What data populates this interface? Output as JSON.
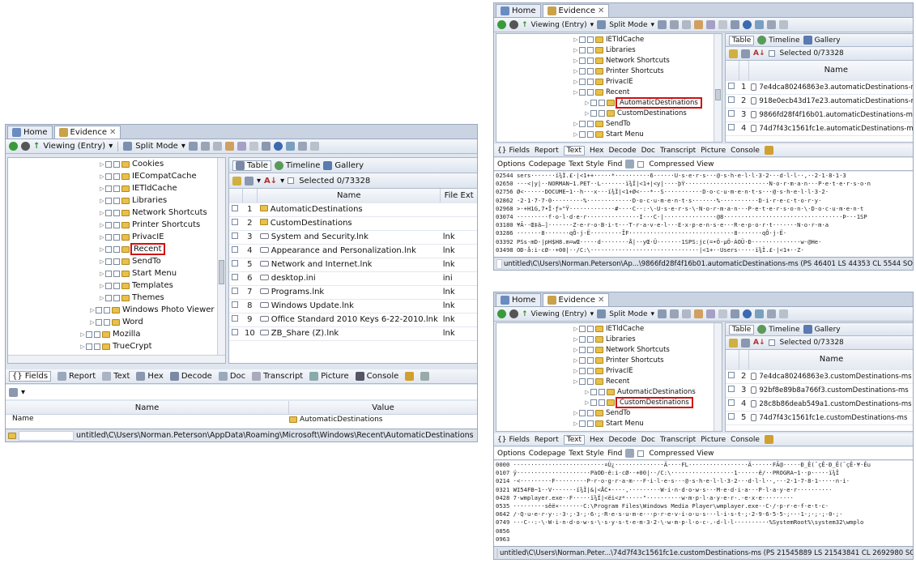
{
  "common": {
    "tab_home": "Home",
    "tab_evidence": "Evidence",
    "viewing": "Viewing (Entry)",
    "split_mode": "Split Mode",
    "table": "Table",
    "timeline": "Timeline",
    "gallery": "Gallery",
    "selected": "Selected 0/73328",
    "col_name": "Name",
    "col_file_ext": "File Ext",
    "fields": "Fields",
    "report": "Report",
    "text": "Text",
    "hex": "Hex",
    "decode": "Decode",
    "doc": "Doc",
    "transcript": "Transcript",
    "picture": "Picture",
    "console": "Console",
    "options": "Options",
    "codepage": "Codepage",
    "text_style": "Text Style",
    "find": "Find",
    "compressed_view": "Compressed View",
    "col_value": "Value"
  },
  "left": {
    "tree": [
      {
        "label": "Cookies",
        "indent": 0
      },
      {
        "label": "IECompatCache",
        "indent": 0
      },
      {
        "label": "IETldCache",
        "indent": 0
      },
      {
        "label": "Libraries",
        "indent": 0
      },
      {
        "label": "Network Shortcuts",
        "indent": 0
      },
      {
        "label": "Printer Shortcuts",
        "indent": 0
      },
      {
        "label": "PrivacIE",
        "indent": 0
      },
      {
        "label": "Recent",
        "indent": 0,
        "hl": true
      },
      {
        "label": "SendTo",
        "indent": 0
      },
      {
        "label": "Start Menu",
        "indent": 0
      },
      {
        "label": "Templates",
        "indent": 0
      },
      {
        "label": "Themes",
        "indent": 0
      },
      {
        "label": "Windows Photo Viewer",
        "indent": -1
      },
      {
        "label": "Word",
        "indent": -1
      },
      {
        "label": "Mozilla",
        "indent": -2
      },
      {
        "label": "TrueCrypt",
        "indent": -2
      }
    ],
    "rows": [
      {
        "n": "1",
        "name": "AutomaticDestinations",
        "ext": "",
        "folder": true
      },
      {
        "n": "2",
        "name": "CustomDestinations",
        "ext": "",
        "folder": true
      },
      {
        "n": "3",
        "name": "System and Security.lnk",
        "ext": "lnk"
      },
      {
        "n": "4",
        "name": "Appearance and Personalization.lnk",
        "ext": "lnk"
      },
      {
        "n": "5",
        "name": "Network and Internet.lnk",
        "ext": "lnk"
      },
      {
        "n": "6",
        "name": "desktop.ini",
        "ext": "ini"
      },
      {
        "n": "7",
        "name": "Programs.lnk",
        "ext": "lnk"
      },
      {
        "n": "8",
        "name": "Windows Update.lnk",
        "ext": "lnk"
      },
      {
        "n": "9",
        "name": "Office Standard 2010 Keys 6-22-2010.lnk",
        "ext": "lnk"
      },
      {
        "n": "10",
        "name": "ZB_Share (Z).lnk",
        "ext": "lnk"
      }
    ],
    "fields_row_name": "Name",
    "fields_row_value": "AutomaticDestinations",
    "status_path": "untitled\\C\\Users\\Norman.Peterson\\AppData\\Roaming\\Microsoft\\Windows\\Recent\\AutomaticDestinations"
  },
  "topright": {
    "tree": [
      {
        "label": "IETldCache"
      },
      {
        "label": "Libraries"
      },
      {
        "label": "Network Shortcuts"
      },
      {
        "label": "Printer Shortcuts"
      },
      {
        "label": "PrivacIE"
      },
      {
        "label": "Recent"
      },
      {
        "label": "AutomaticDestinations",
        "sub": true,
        "hl": true
      },
      {
        "label": "CustomDestinations",
        "sub": true
      },
      {
        "label": "SendTo"
      },
      {
        "label": "Start Menu"
      }
    ],
    "rows": [
      {
        "n": "1",
        "name": "7e4dca80246863e3.automaticDestinations-ms"
      },
      {
        "n": "2",
        "name": "918e0ecb43d17e23.automaticDestinations-ms"
      },
      {
        "n": "3",
        "name": "9866fd28f4f16b01.automaticDestinations-ms"
      },
      {
        "n": "4",
        "name": "74d7f43c1561fc1e.automaticDestinations-ms"
      }
    ],
    "hex": [
      "02544 sers·······ï¾Ï.£·|<1++·····*··········6······U·s·e·r·s···@·s·h·e·l·l·3·2···d·l·l··,··2·1·8·1·3",
      "02650 ···<|y|··NORMAN~1.PET··L·······ï¾Ï|<1+|<y|····þÝ························N·o·r·m·a·n···P·e·t·e·r·s·o·n",
      "02756 Ø<······DOCUME~1··h···x···ï¾Ï|<1+Ø<···*··S···········D·o·c·u·m·e·n·t·s···@·s·h·e·l·l·3·2·",
      "02862 ·2·1·7·7·0·········%·············D·o·c·u·m·e·n·t·s·······%···········D·i·r·e·c·t·o·r·y·",
      "02968 >·+H1G,7•Î·ƒ»\"Ÿ·············#····C··:·\\·U·s·e·r·s·\\·N·o·r·m·a·n···P·e·t·e·r·s·o·n·\\·D·o·c·u·m·e·n·t",
      "03074 ·········f·o·l·d·e·r···············I···C·|···············@8··································Þ···1SP",
      "03180 ¥Ã··Œ‡ä—]·······Z·e·r·o·B·i·t···T·r·a·v·e·l···E·x·p·e·n·s·e···R·e·p·o·r·t···-···N·o·r·m·a",
      "03286 ·······8·······qÔ·j·Ë·········ÎF······························8·······qÔ·j·Ë·",
      "03392 PSs·mD-|pH$H8.m=wŒ·····d········Å|··yŒ·Ü·······1SPS:jc(=•Ö·µÖ·ÀOÜ·Ð··············w·@He·",
      "03498 OÐ·å:i·cØ··+00|··/C:\\·······························|<1+··Users·····ï¾Ï.£·|<1+··Z·"
    ],
    "status_path": "untitled\\C\\Users\\Norman.Peterson\\Ap...\\9866fd28f4f16b01.automaticDestinations-ms (PS 46401 LS 44353 CL 5544 SO"
  },
  "bottomright": {
    "tree": [
      {
        "label": "IETldCache"
      },
      {
        "label": "Libraries"
      },
      {
        "label": "Network Shortcuts"
      },
      {
        "label": "Printer Shortcuts"
      },
      {
        "label": "PrivacIE"
      },
      {
        "label": "Recent"
      },
      {
        "label": "AutomaticDestinations",
        "sub": true
      },
      {
        "label": "CustomDestinations",
        "sub": true,
        "hl": true
      },
      {
        "label": "SendTo"
      },
      {
        "label": "Start Menu"
      }
    ],
    "rows": [
      {
        "n": "2",
        "name": "7e4dca80246863e3.customDestinations-ms"
      },
      {
        "n": "3",
        "name": "92bf8e89b8a766f3.customDestinations-ms"
      },
      {
        "n": "4",
        "name": "28c8b86deab549a1.customDestinations-ms"
      },
      {
        "n": "5",
        "name": "74d7f43c1561fc1e.customDestinations-ms"
      }
    ],
    "hex": [
      "0000 ··························¤Ù¿··············Ä····FL·················Ä······FÃ@·····Ð_Ê(¯çÊ·Ð_Ê(¯çÊ·¥·Êu",
      "0107 ÿ·····················PàOÐ·ê:i·cØ··+00|··/C:\\··················1······ê/··PROGRA~1··p·····ï¾Ï",
      "0214 ·<·········F·········P·r·o·g·r·a·m···F·i·l·e·s···@·s·h·e·l·l·3·2···d·l·l··,···2·1·7·8·1·····n·i·",
      "0321 WI54FB~1··V·······ï¾Ï|&|<ÅC•····,·········W·i·n·d·o·w·s···M·e·d·i·a···P·l·a·y·e·r··········",
      "0428 7·wmplayer.exe··F·····ï¾Ï|<ëi<z*·····\"··········w·m·p·l·a·y·e·r·.·e·x·e·········",
      "0535 ·········sêë×·······C:\\Program Files\\Windows Media Player\\wmplayer.exe··C·/·p·r·e·f·e·t·c·",
      "0642 /·Q·u·e·r·y·:·3·;·3·;·6·;·R·e·s·u·m·e···p·r·e·v·i·o·u·s···l·i·s·t·;·2·9·6·5·5·;·-·1·;·;·;·0·;·",
      "0749 ···C··:·\\·W·i·n·d·o·w·s·\\·s·y·s·t·e·m·3·2·\\·w·m·p·l·o·c·.·d·l·l··········%SystemRoot%\\system32\\wmplo",
      "0856 ",
      "0963 "
    ],
    "status_path": "untitled\\C\\Users\\Norman.Peter...\\74d7f43c1561fc1e.customDestinations-ms (PS 21545889 LS 21543841 CL 2692980 SO"
  },
  "colors": {
    "highlight_border": "#d01010",
    "folder": "#e8c04a"
  }
}
